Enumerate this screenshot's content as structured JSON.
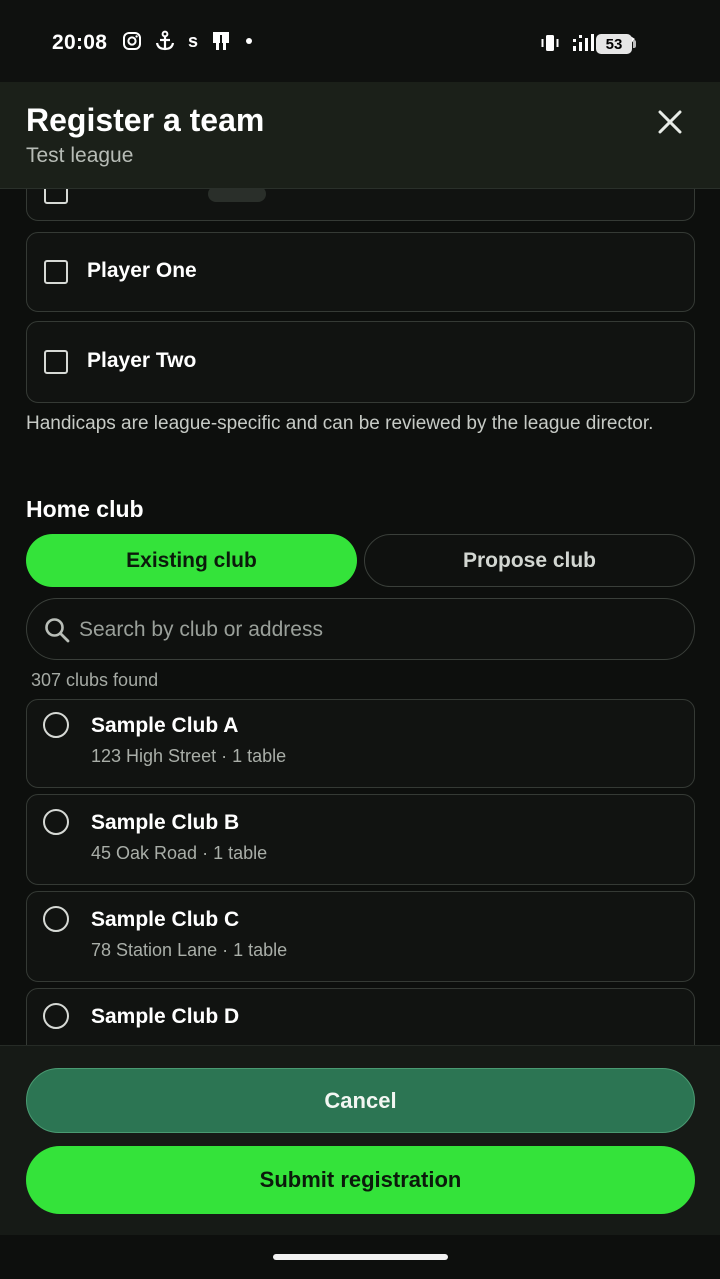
{
  "status_bar": {
    "time": "20:08",
    "battery": "53",
    "icons": [
      "instagram-icon",
      "anchor-icon",
      "s-app-icon",
      "cast-icon",
      "dot-icon",
      "vibrate-icon",
      "signal-icon",
      "wifi-icon",
      "battery-icon"
    ],
    "s_glyph": "s"
  },
  "header": {
    "title": "Register a team",
    "subtitle": "Test league",
    "close_icon": "close-icon"
  },
  "players": [
    {
      "name": "Player One"
    },
    {
      "name": "Player Two"
    }
  ],
  "handicap_note": "Handicaps are league-specific and can be reviewed by the league director.",
  "home_club": {
    "title": "Home club",
    "tabs": [
      {
        "label": "Existing club",
        "active": true
      },
      {
        "label": "Propose club",
        "active": false
      }
    ],
    "search": {
      "placeholder": "Search by club or address",
      "value": ""
    },
    "count_text": "307 clubs found",
    "clubs": [
      {
        "name": "Sample Club A",
        "meta": "123 High Street · 1 table"
      },
      {
        "name": "Sample Club B",
        "meta": "45 Oak Road · 1 table"
      },
      {
        "name": "Sample Club C",
        "meta": "78 Station Lane · 1 table"
      },
      {
        "name": "Sample Club D",
        "meta": ""
      }
    ]
  },
  "footer": {
    "cancel_label": "Cancel",
    "submit_label": "Submit registration"
  },
  "colors": {
    "accent": "#34e33a",
    "cancel_bg": "#2c7553",
    "background": "#0d0f0d",
    "header_bg": "#1b2019"
  }
}
